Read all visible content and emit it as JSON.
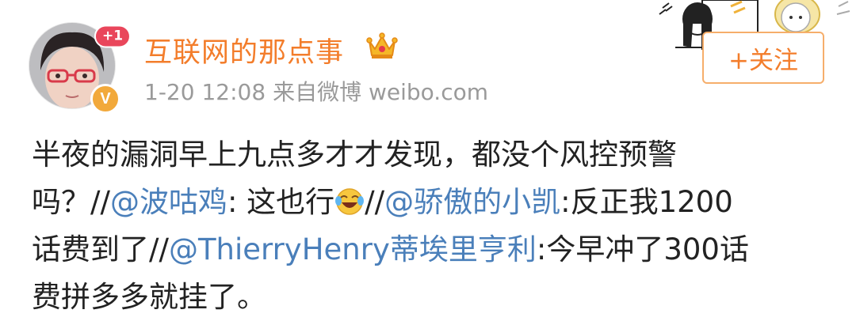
{
  "user": {
    "name": "互联网的那点事",
    "plus_badge": "+1",
    "verified_badge": "V"
  },
  "meta": {
    "date": "1-20",
    "time": "12:08",
    "from_label": "来自微博",
    "source": "weibo.com"
  },
  "follow_button": {
    "label": "+关注"
  },
  "post": {
    "line1": "半夜的漏洞早上九点多才才发现，都没个风控预警",
    "line2_a": "吗？//",
    "mention1": "@波咕鸡",
    "line2_b": ": 这也行",
    "emoji": "laughing-tears",
    "line2_c": "//",
    "mention2": "@骄傲的小凯",
    "line2_d": ":反正我1200",
    "line3_a": "话费到了//",
    "mention3": "@ThierryHenry蒂埃里亨利",
    "line3_b": ":今早冲了300话",
    "line4": "费拼多多就挂了。"
  },
  "colors": {
    "username": "#f37d2b",
    "mention": "#4a7fba",
    "meta": "#9a9a9a",
    "follow_border": "#f6ae6b"
  }
}
